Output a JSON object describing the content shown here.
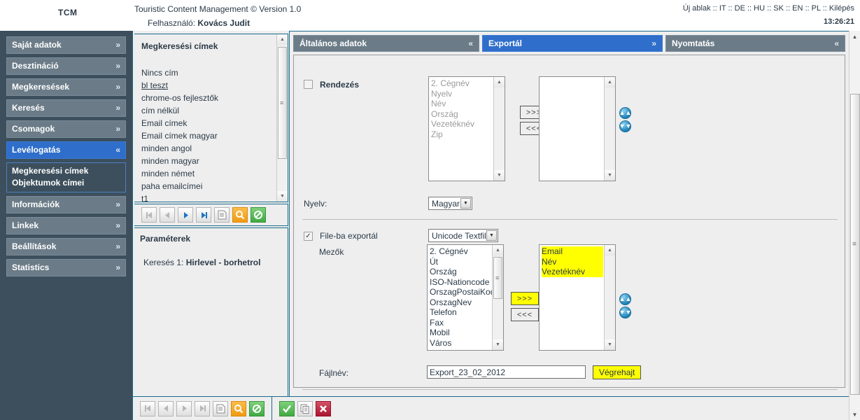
{
  "header": {
    "brand": "TCM",
    "app_title": "Touristic Content Management © Version 1.0",
    "user_label": "Felhasználó:",
    "user_name": "Kovács Judit",
    "lang_links": "Új ablak :: IT :: DE :: HU :: SK :: EN :: PL :: Kilépés",
    "clock": "13:26:21"
  },
  "sidebar": {
    "items": [
      {
        "label": "Saját adatok",
        "chevron": "»",
        "active": false
      },
      {
        "label": "Desztináció",
        "chevron": "»",
        "active": false
      },
      {
        "label": "Megkeresések",
        "chevron": "»",
        "active": false
      },
      {
        "label": "Keresés",
        "chevron": "»",
        "active": false
      },
      {
        "label": "Csomagok",
        "chevron": "»",
        "active": false
      },
      {
        "label": "Levélogatás",
        "chevron": "«",
        "active": true
      },
      {
        "label": "Információk",
        "chevron": "»",
        "active": false
      },
      {
        "label": "Linkek",
        "chevron": "»",
        "active": false
      },
      {
        "label": "Beállítások",
        "chevron": "»",
        "active": false
      },
      {
        "label": "Statistics",
        "chevron": "»",
        "active": false
      }
    ],
    "submenu": [
      "Megkeresési címek",
      "Objektumok címei"
    ]
  },
  "middle": {
    "list_title": "Megkeresési címek",
    "list_items": [
      {
        "label": "Nincs cím",
        "selected": false
      },
      {
        "label": "bl teszt",
        "selected": true
      },
      {
        "label": "chrome-os fejlesztők",
        "selected": false
      },
      {
        "label": "cím nélkül",
        "selected": false
      },
      {
        "label": "Email címek",
        "selected": false
      },
      {
        "label": "Email címek magyar",
        "selected": false
      },
      {
        "label": "minden angol",
        "selected": false
      },
      {
        "label": "minden magyar",
        "selected": false
      },
      {
        "label": "minden német",
        "selected": false
      },
      {
        "label": "paha emailcímei",
        "selected": false
      },
      {
        "label": "t1",
        "selected": false
      }
    ],
    "params_title": "Paraméterek",
    "params_label": "Keresés 1:",
    "params_value": "Hirlevel - borhetrol",
    "toolbar": [
      {
        "icon": "first-page-icon",
        "state": "disabled"
      },
      {
        "icon": "previous-page-icon",
        "state": "disabled"
      },
      {
        "icon": "next-page-icon",
        "state": "enabled"
      },
      {
        "icon": "last-page-icon",
        "state": "enabled"
      },
      {
        "icon": "new-document-icon",
        "state": "enabled"
      },
      {
        "icon": "search-icon",
        "state": "enabled"
      },
      {
        "icon": "refresh-icon",
        "state": "enabled"
      }
    ]
  },
  "sections": [
    {
      "label": "Általános adatok",
      "chevron": "«",
      "active": false
    },
    {
      "label": "Exportál",
      "chevron": "»",
      "active": true
    },
    {
      "label": "Nyomtatás",
      "chevron": "«",
      "active": false
    }
  ],
  "export": {
    "sort_checkbox_label": "Rendezés",
    "sort_checked": false,
    "sort_available": [
      "2. Cégnév",
      "Nyelv",
      "Név",
      "Ország",
      "Vezetéknév",
      "Zip"
    ],
    "sort_selected": [],
    "move_right_label": ">>>",
    "move_left_label": "<<<",
    "up_icon": "chevron-double-up-icon",
    "down_icon": "chevron-double-down-icon",
    "language_label": "Nyelv:",
    "language_value": "Magyar",
    "file_export_label": "File-ba exportál",
    "file_export_checked": true,
    "file_format_value": "Unicode Textfile",
    "fields_label": "Mezők",
    "fields_available": [
      "2. Cégnév",
      "Út",
      "Ország",
      "ISO-Nationcode",
      "OrszagPostaiKod",
      "OrszagNev",
      "Telefon",
      "Fax",
      "Mobil",
      "Város"
    ],
    "fields_selected": [
      {
        "label": "Email",
        "highlighted": true
      },
      {
        "label": "Név",
        "highlighted": true
      },
      {
        "label": "Vezetéknév",
        "highlighted": true
      }
    ],
    "filename_label": "Fájlnév:",
    "filename_value": "Export_23_02_2012",
    "execute_label": "Végrehajt"
  },
  "bottom_toolbar": {
    "nav": [
      {
        "icon": "first-page-icon",
        "state": "disabled"
      },
      {
        "icon": "previous-page-icon",
        "state": "disabled"
      },
      {
        "icon": "next-page-icon",
        "state": "disabled"
      },
      {
        "icon": "last-page-icon",
        "state": "disabled"
      },
      {
        "icon": "new-document-icon",
        "state": "enabled"
      },
      {
        "icon": "search-icon",
        "state": "enabled"
      },
      {
        "icon": "refresh-icon",
        "state": "enabled"
      }
    ],
    "actions": [
      {
        "icon": "save-check-icon"
      },
      {
        "icon": "copy-icon"
      },
      {
        "icon": "delete-x-icon"
      }
    ]
  },
  "colors": {
    "accent_blue": "#2f6ecb",
    "sidebar_bg": "#3d4f5c",
    "nav_bg": "#6b7c88",
    "panel_border": "#1a6b8a",
    "highlight_yellow": "#ffff00"
  }
}
